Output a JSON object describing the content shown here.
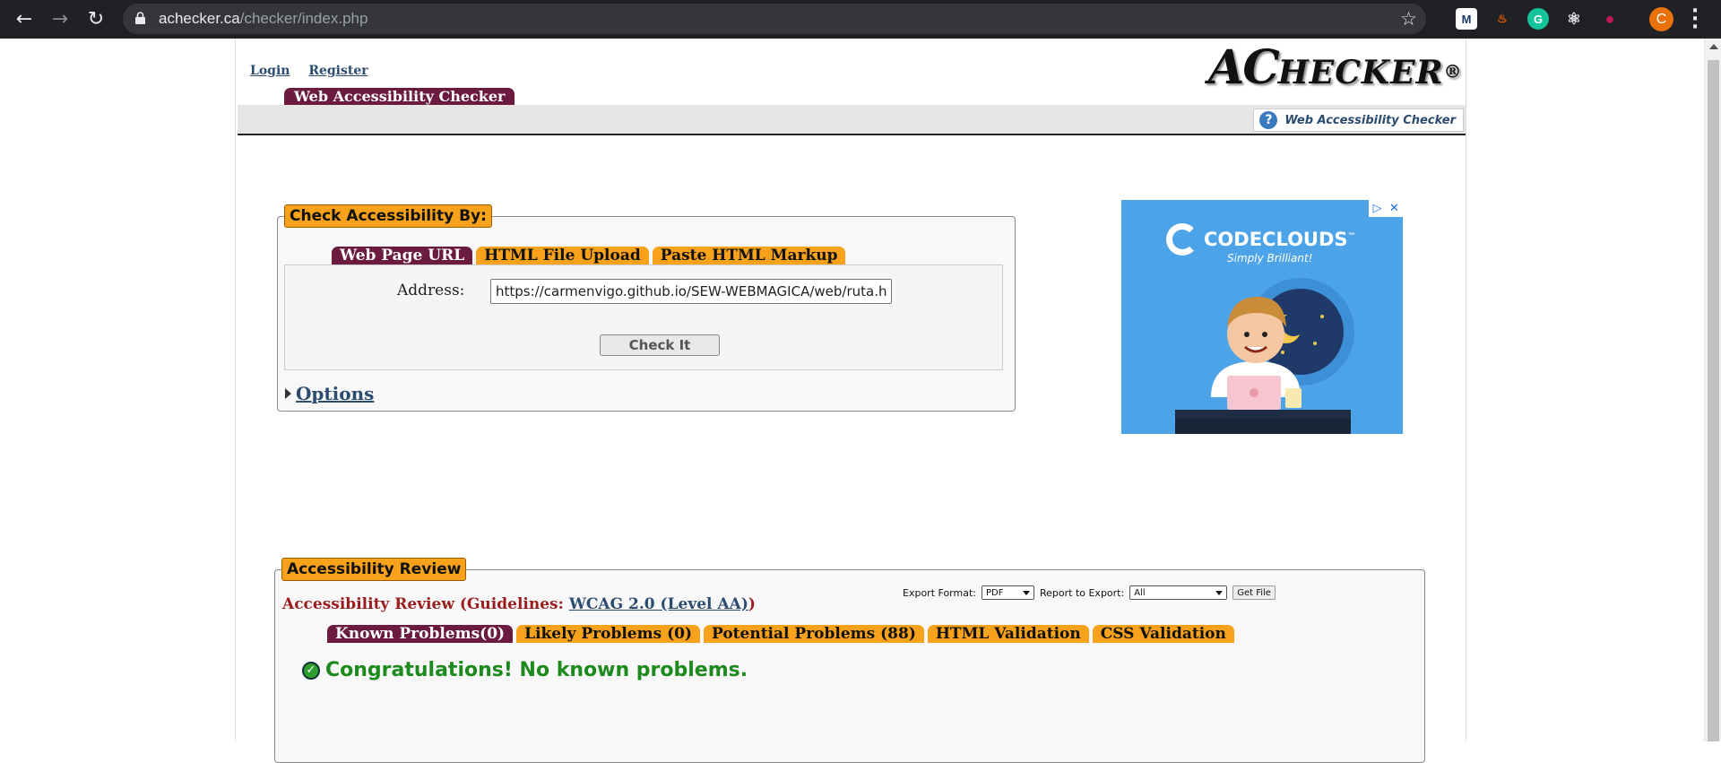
{
  "browser": {
    "url_host": "achecker.ca",
    "url_path": "/checker/index.php",
    "extensions": [
      {
        "name": "mailtrack-icon",
        "glyph": "M",
        "bg": "#ffffff",
        "fg": "#1a3a6b"
      },
      {
        "name": "extension-fire-icon",
        "glyph": "♨",
        "bg": "#202124",
        "fg": "#e8590c"
      },
      {
        "name": "grammarly-icon",
        "glyph": "G",
        "bg": "#15c39a",
        "fg": "#ffffff"
      },
      {
        "name": "react-devtools-icon",
        "glyph": "⚛",
        "bg": "#202124",
        "fg": "#e8eaed"
      },
      {
        "name": "extension-pink-icon",
        "glyph": "●",
        "bg": "#202124",
        "fg": "#c2185b"
      }
    ],
    "profile_initial": "C"
  },
  "header": {
    "login": "Login",
    "register": "Register",
    "logo_big": "AC",
    "logo_small": "HECKER",
    "logo_reg": "®",
    "main_tab": "Web Accessibility Checker",
    "help_link": "Web Accessibility Checker"
  },
  "check": {
    "legend": "Check Accessibility By:",
    "tabs": [
      "Web Page URL",
      "HTML File Upload",
      "Paste HTML Markup"
    ],
    "active_tab": 0,
    "address_label": "Address:",
    "address_value": "https://carmenvigo.github.io/SEW-WEBMAGICA/web/ruta.h",
    "check_button": "Check It",
    "options_link": "Options"
  },
  "ad": {
    "brand": "CODECLOUDS",
    "tm": "™",
    "tagline": "Simply Brilliant!"
  },
  "review": {
    "legend": "Accessibility Review",
    "heading_prefix": "Accessibility Review (Guidelines: ",
    "guideline_link": "WCAG 2.0 (Level AA)",
    "heading_suffix": ")",
    "export_format_label": "Export Format:",
    "export_format_value": "PDF",
    "report_label": "Report to Export:",
    "report_value": "All",
    "get_file": "Get File",
    "tabs": [
      "Known Problems(0)",
      "Likely Problems (0)",
      "Potential Problems (88)",
      "HTML Validation",
      "CSS Validation"
    ],
    "active_tab": 0,
    "congrats": "Congratulations! No known problems."
  },
  "colors": {
    "tab_active": "#6a1b3f",
    "tab_inactive": "#f7a21a",
    "link": "#2b4c6f",
    "success": "#1d8a1d"
  }
}
